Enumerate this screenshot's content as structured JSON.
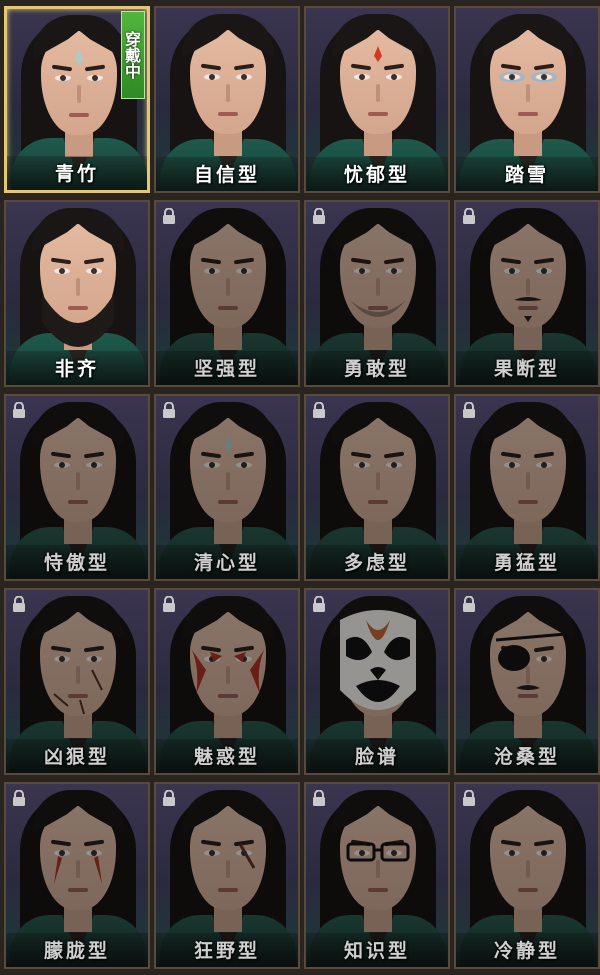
{
  "wearing_badge": "穿戴中",
  "styles": [
    {
      "label": "青竹",
      "locked": false,
      "selected": true,
      "wearing": true,
      "feature": "forehead-mark"
    },
    {
      "label": "自信型",
      "locked": false,
      "selected": false,
      "wearing": false,
      "feature": "none"
    },
    {
      "label": "忧郁型",
      "locked": false,
      "selected": false,
      "wearing": false,
      "feature": "red-forehead-mark"
    },
    {
      "label": "踏雪",
      "locked": false,
      "selected": false,
      "wearing": false,
      "feature": "eye-makeup"
    },
    {
      "label": "非齐",
      "locked": false,
      "selected": false,
      "wearing": false,
      "feature": "full-beard"
    },
    {
      "label": "坚强型",
      "locked": true,
      "selected": false,
      "wearing": false,
      "feature": "none"
    },
    {
      "label": "勇敢型",
      "locked": true,
      "selected": false,
      "wearing": false,
      "feature": "stubble"
    },
    {
      "label": "果断型",
      "locked": true,
      "selected": false,
      "wearing": false,
      "feature": "mustache"
    },
    {
      "label": "恃傲型",
      "locked": true,
      "selected": false,
      "wearing": false,
      "feature": "none"
    },
    {
      "label": "清心型",
      "locked": true,
      "selected": false,
      "wearing": false,
      "feature": "forehead-mark"
    },
    {
      "label": "多虑型",
      "locked": true,
      "selected": false,
      "wearing": false,
      "feature": "none"
    },
    {
      "label": "勇猛型",
      "locked": true,
      "selected": false,
      "wearing": false,
      "feature": "none"
    },
    {
      "label": "凶狠型",
      "locked": true,
      "selected": false,
      "wearing": false,
      "feature": "scars"
    },
    {
      "label": "魅惑型",
      "locked": true,
      "selected": false,
      "wearing": false,
      "feature": "red-face-paint"
    },
    {
      "label": "脸谱",
      "locked": true,
      "selected": false,
      "wearing": false,
      "feature": "opera-mask"
    },
    {
      "label": "沧桑型",
      "locked": true,
      "selected": false,
      "wearing": false,
      "feature": "eyepatch"
    },
    {
      "label": "朦胧型",
      "locked": true,
      "selected": false,
      "wearing": false,
      "feature": "red-tear-paint"
    },
    {
      "label": "狂野型",
      "locked": true,
      "selected": false,
      "wearing": false,
      "feature": "scar"
    },
    {
      "label": "知识型",
      "locked": true,
      "selected": false,
      "wearing": false,
      "feature": "glasses"
    },
    {
      "label": "冷静型",
      "locked": true,
      "selected": false,
      "wearing": false,
      "feature": "none"
    }
  ]
}
